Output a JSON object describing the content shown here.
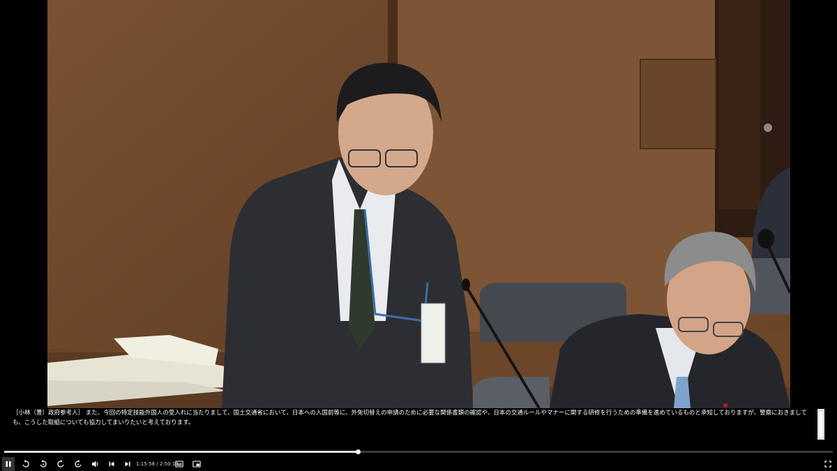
{
  "caption": {
    "text": "［小林（豊）政府参考人］ また、今回の特定技能外国人の受入れに当たりまして、国土交通省において、日本への入国前等に、外免切替えの申請のために必要な関係書類の確認や、日本の交通ルールやマナーに関する研修を行うための準備を進めているものと承知しておりますが、警察におきましても、こうした取組についても協力してまいりたいと考えております。"
  },
  "playback": {
    "current_time": "1:15:58",
    "separator": "/",
    "total_time": "2:50:19",
    "progress_fraction": 0.427
  },
  "controls": {
    "play_pause": "pause-icon",
    "replay_small": "rewind-icon",
    "replay_large": "rewind-large-icon",
    "forward_small": "forward-icon",
    "forward_large": "forward-large-icon",
    "volume": "volume-icon",
    "prev": "skip-previous-icon",
    "next": "skip-next-icon",
    "captions": "captions-icon",
    "pip": "picture-in-picture-icon",
    "fullscreen": "fullscreen-icon"
  },
  "colors": {
    "background": "#000000",
    "progress_fill": "#dddddd",
    "progress_track": "#3a3a3a",
    "wall_panel": "#7a5233",
    "caption_text": "#ffffff"
  }
}
